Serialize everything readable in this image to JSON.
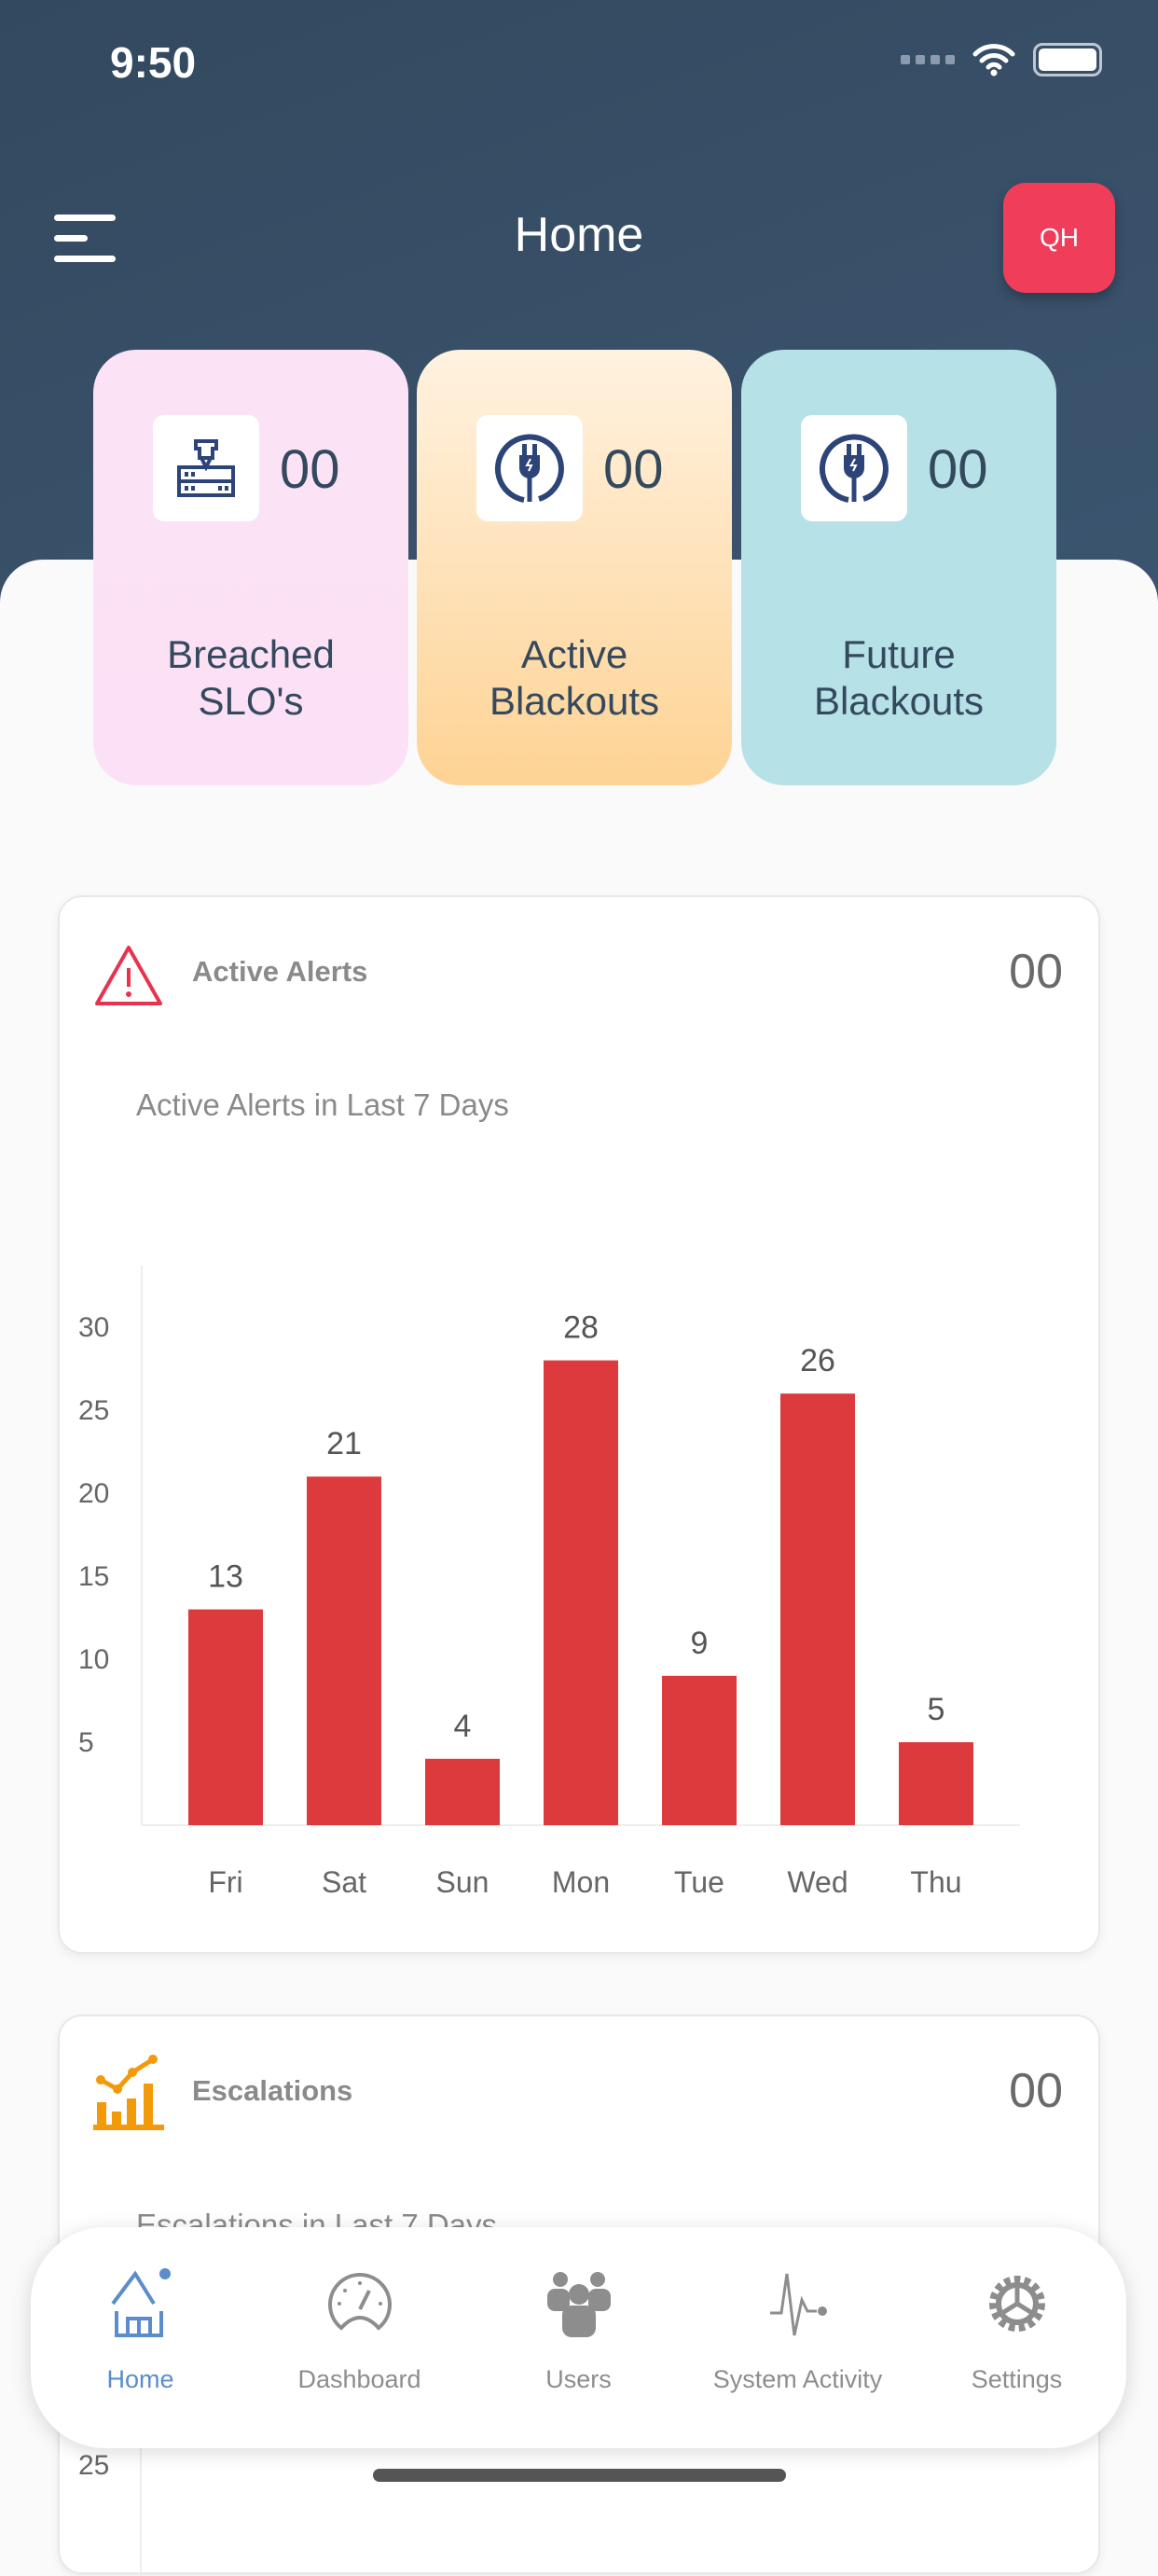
{
  "status_bar": {
    "time": "9:50"
  },
  "header": {
    "title": "Home",
    "avatar_initials": "QH"
  },
  "stats": [
    {
      "value": "00",
      "label_line1": "Breached",
      "label_line2": "SLO's",
      "icon": "server-award-icon"
    },
    {
      "value": "00",
      "label_line1": "Active",
      "label_line2": "Blackouts",
      "icon": "power-plug-icon"
    },
    {
      "value": "00",
      "label_line1": "Future",
      "label_line2": "Blackouts",
      "icon": "power-plug-icon"
    }
  ],
  "alerts_card": {
    "title": "Active Alerts",
    "count": "00",
    "subtitle": "Active Alerts in Last 7 Days"
  },
  "escalations_card": {
    "title": "Escalations",
    "count": "00",
    "subtitle": "Escalations in Last 7 Days",
    "visible_tick": "25"
  },
  "chart_data": {
    "type": "bar",
    "categories": [
      "Fri",
      "Sat",
      "Sun",
      "Mon",
      "Tue",
      "Wed",
      "Thu"
    ],
    "values": [
      13,
      21,
      4,
      28,
      9,
      26,
      5
    ],
    "yticks": [
      5,
      10,
      15,
      20,
      25,
      30
    ],
    "ylim": [
      0,
      33
    ],
    "color": "#dc3a3d",
    "grid": false
  },
  "tabs": [
    {
      "label": "Home",
      "active": true
    },
    {
      "label": "Dashboard"
    },
    {
      "label": "Users"
    },
    {
      "label": "System Activity"
    },
    {
      "label": "Settings"
    }
  ],
  "colors": {
    "header": "#34495e",
    "accent": "#ef3d5a",
    "active_tab": "#5b8ccc"
  }
}
